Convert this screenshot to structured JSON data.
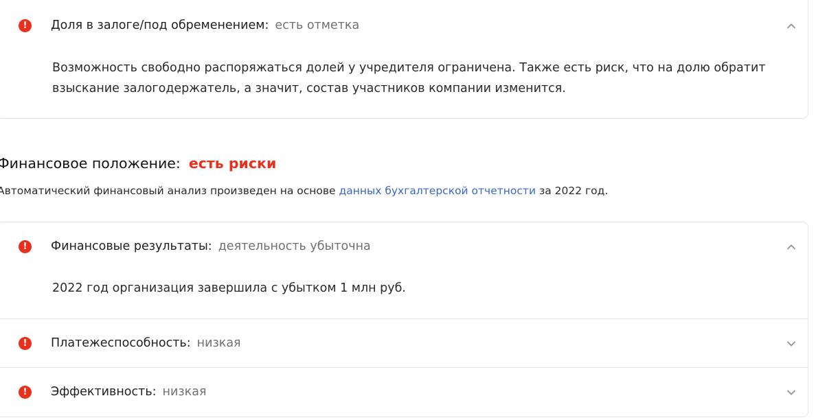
{
  "pledge_card": {
    "title": "Доля в залоге/под обременением:",
    "status": "есть отметка",
    "body": "Возможность свободно распоряжаться долей у учредителя ограничена. Также есть риск, что на долю обратит взыскание залогодержатель, а значит, состав участников компании изменится.",
    "icon": "alert-icon",
    "chevron": "chevron-up-icon"
  },
  "financial_section": {
    "title": "Финансовое положение:",
    "status": "есть риски",
    "desc_prefix": "Автоматический финансовый анализ произведен на основе",
    "desc_link": "данных бухгалтерской отчетности",
    "desc_suffix": "за 2022 год.",
    "link_color": "#3a66d1",
    "risk_color": "#e8301c"
  },
  "financial_items": [
    {
      "title": "Финансовые результаты:",
      "status": "деятельность убыточна",
      "body": "2022 год организация завершила с убытком 1 млн руб.",
      "expanded": true,
      "chevron": "chevron-up-icon"
    },
    {
      "title": "Платежеспособность:",
      "status": "низкая",
      "expanded": false,
      "chevron": "chevron-down-icon"
    },
    {
      "title": "Эффективность:",
      "status": "низкая",
      "expanded": false,
      "chevron": "chevron-down-icon"
    }
  ]
}
